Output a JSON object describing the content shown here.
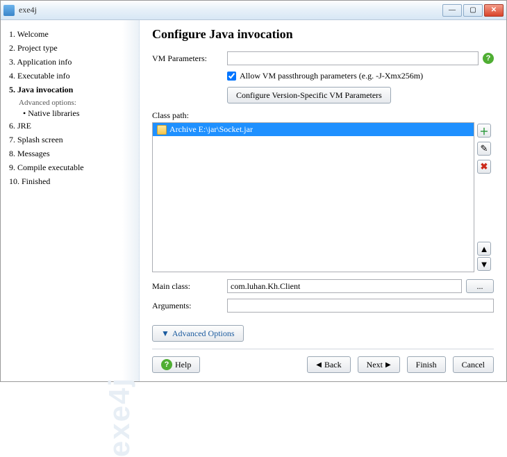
{
  "title": "exe4j",
  "sidebar": {
    "items": [
      {
        "label": "1. Welcome"
      },
      {
        "label": "2. Project type"
      },
      {
        "label": "3. Application info"
      },
      {
        "label": "4. Executable info"
      },
      {
        "label": "5. Java invocation",
        "current": true
      },
      {
        "label": "6. JRE"
      },
      {
        "label": "7. Splash screen"
      },
      {
        "label": "8. Messages"
      },
      {
        "label": "9. Compile executable"
      },
      {
        "label": "10. Finished"
      }
    ],
    "advanced_heading": "Advanced options:",
    "advanced_items": [
      {
        "label": "• Native libraries"
      }
    ],
    "watermark": "exe4j"
  },
  "main": {
    "heading": "Configure Java invocation",
    "vm_params_label": "VM Parameters:",
    "vm_params_value": "",
    "allow_passthrough_checked": true,
    "allow_passthrough_label": "Allow VM passthrough parameters (e.g. -J-Xmx256m)",
    "cfg_version_btn": "Configure Version-Specific VM Parameters",
    "classpath_label": "Class path:",
    "classpath_items": [
      {
        "text": "Archive  E:\\jar\\Socket.jar",
        "selected": true
      }
    ],
    "main_class_label": "Main class:",
    "main_class_value": "com.luhan.Kh.Client",
    "arguments_label": "Arguments:",
    "arguments_value": "",
    "advanced_options_btn": "Advanced Options",
    "browse_btn": "..."
  },
  "footer": {
    "help": "Help",
    "back": "Back",
    "next": "Next",
    "finish": "Finish",
    "cancel": "Cancel"
  }
}
